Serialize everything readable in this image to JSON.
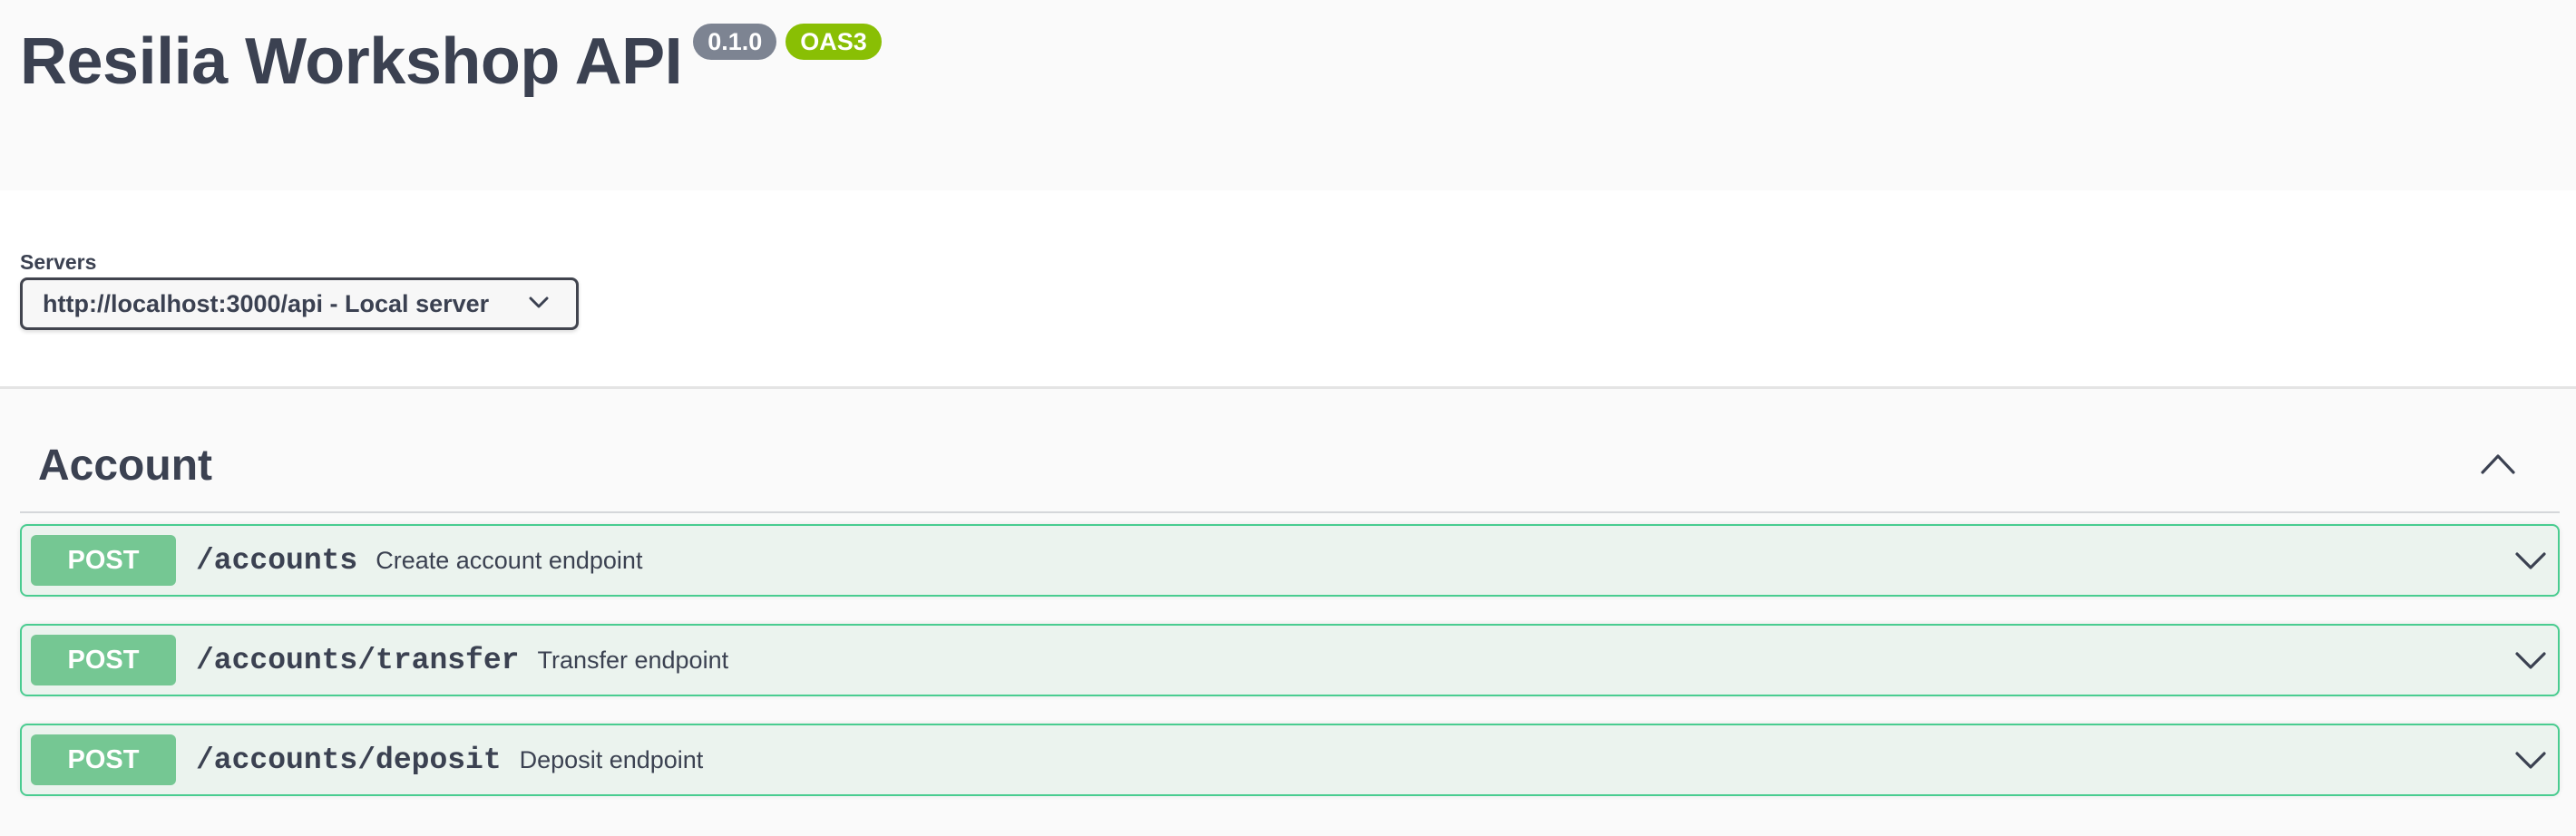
{
  "info": {
    "title": "Resilia Workshop API",
    "version": "0.1.0",
    "spec_badge": "OAS3"
  },
  "servers": {
    "label": "Servers",
    "selected": "http://localhost:3000/api - Local server",
    "options": [
      "http://localhost:3000/api - Local server"
    ]
  },
  "tag": {
    "name": "Account",
    "expanded": true,
    "operations": [
      {
        "method": "POST",
        "path": "/accounts",
        "summary": "Create account endpoint"
      },
      {
        "method": "POST",
        "path": "/accounts/transfer",
        "summary": "Transfer endpoint"
      },
      {
        "method": "POST",
        "path": "/accounts/deposit",
        "summary": "Deposit endpoint"
      }
    ]
  },
  "colors": {
    "post_accent": "#49cc90",
    "post_badge": "#75c793",
    "post_background": "#ebf3ee",
    "version_badge": "#7d8492",
    "oas_badge": "#89bf04",
    "text": "#3b4151"
  },
  "icons": {
    "server_select": "chevron-down-icon",
    "tag_toggle": "chevron-up-icon",
    "operation_expand": "chevron-down-icon"
  }
}
